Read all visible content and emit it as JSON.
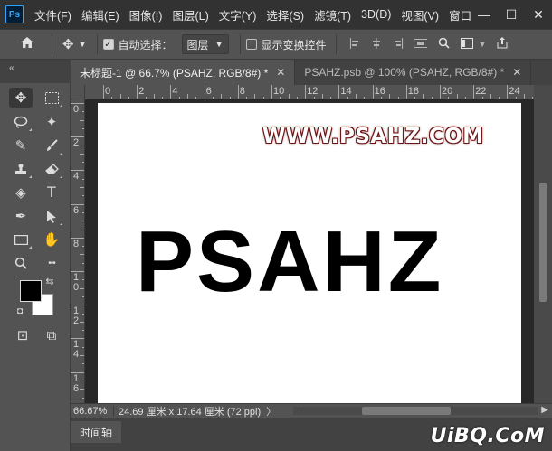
{
  "app": {
    "logo_text": "Ps",
    "brand_color": "#31a8ff"
  },
  "menubar": {
    "items": [
      "文件(F)",
      "编辑(E)",
      "图像(I)",
      "图层(L)",
      "文字(Y)",
      "选择(S)",
      "滤镜(T)",
      "3D(D)",
      "视图(V)",
      "窗口"
    ],
    "window_controls": [
      "—",
      "☐",
      "✕"
    ]
  },
  "options": {
    "auto_select_label": "自动选择：",
    "auto_select_checked": true,
    "target_value": "图层",
    "show_transform_label": "显示变换控件",
    "show_transform_checked": false
  },
  "tabs": [
    {
      "label": "未标题-1 @ 66.7% (PSAHZ, RGB/8#) *",
      "active": true
    },
    {
      "label": "PSAHZ.psb @ 100% (PSAHZ, RGB/8#) *",
      "active": false
    }
  ],
  "rulers": {
    "top_labels": [
      "0",
      "2",
      "4",
      "6",
      "8",
      "10",
      "12",
      "14",
      "16",
      "18",
      "20",
      "22",
      "24"
    ],
    "left_labels": [
      "0",
      "2",
      "4",
      "6",
      "8",
      "1\n0",
      "1\n2",
      "1\n4",
      "1\n6"
    ]
  },
  "canvas": {
    "watermark_text": "WWW.PSAHZ.COM",
    "main_text": "PSAHZ"
  },
  "status": {
    "zoom": "66.67%",
    "doc_info": "24.69 厘米 x 17.64 厘米 (72 ppi)",
    "arrow": "〉"
  },
  "timeline": {
    "label": "时间轴"
  },
  "site_watermark": "UiBQ.CoM",
  "collapse_glyph": "«",
  "tool_icons": {
    "move": "✥",
    "marquee": "⬚",
    "lasso": "◌",
    "magic_wand": "✦",
    "eyedropper": "✎",
    "brush": "⟋",
    "stamp": "♜",
    "eraser": "⌫",
    "bucket": "◈",
    "type": "T",
    "pen": "✒",
    "select_arrow": "➤",
    "rectangle": "▭",
    "hand": "✋",
    "zoom": "⌕",
    "more": "•••",
    "swap": "⇆",
    "default_colors": "◘",
    "quick_mask": "⊡",
    "screen_mode": "⧉"
  }
}
